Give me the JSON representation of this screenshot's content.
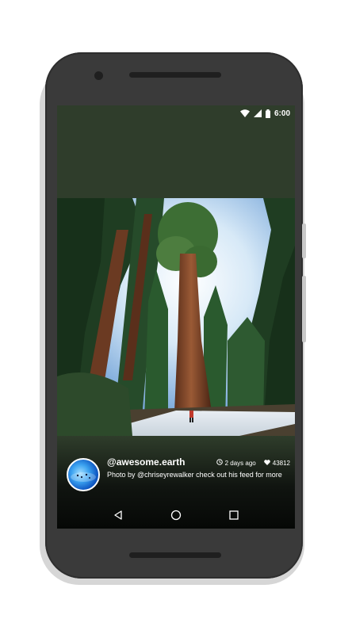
{
  "status_bar": {
    "time": "6:00",
    "icons": [
      "wifi-icon",
      "cellular-signal-icon",
      "battery-icon"
    ]
  },
  "post": {
    "image": "giant-sequoia-forest-photo",
    "avatar": "earth-avatar",
    "username": "@awesome.earth",
    "time_ago": "2 days ago",
    "likes": "43812",
    "caption": "Photo by @chriseyrewalker check out his feed for more"
  },
  "nav_bar": {
    "buttons": [
      "back-icon",
      "home-icon",
      "recents-icon"
    ]
  },
  "colors": {
    "screen_background": "#2f3d2b",
    "phone_body": "#3a3a3a",
    "text": "#ffffff"
  }
}
